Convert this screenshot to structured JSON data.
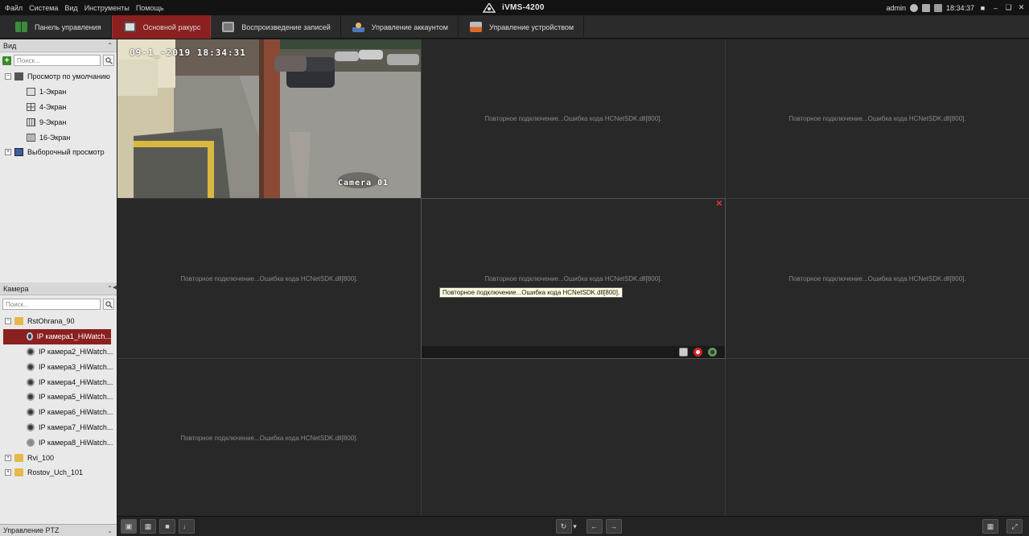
{
  "menubar": {
    "items": [
      "Файл",
      "Система",
      "Вид",
      "Инструменты",
      "Помощь"
    ],
    "app_title": "iVMS-4200",
    "user": "admin",
    "time": "18:34:37"
  },
  "tabs": [
    {
      "label": "Панель управления",
      "icon": "dashboard-icon",
      "active": false
    },
    {
      "label": "Основной ракурс",
      "icon": "main-view-icon",
      "active": true
    },
    {
      "label": "Воспроизведение записей",
      "icon": "playback-icon",
      "active": false
    },
    {
      "label": "Управление аккаунтом",
      "icon": "account-icon",
      "active": false
    },
    {
      "label": "Управление устройством",
      "icon": "device-icon",
      "active": false
    }
  ],
  "view_panel": {
    "title": "Вид",
    "search_placeholder": "Поиск...",
    "default_view": "Просмотр по умолчанию",
    "screens": [
      "1-Экран",
      "4-Экран",
      "9-Экран",
      "16-Экран"
    ],
    "custom_view": "Выборочный просмотр"
  },
  "camera_panel": {
    "title": "Камера",
    "search_placeholder": "Поиск...",
    "group": "RstOhrana_90",
    "cameras": [
      "IP камера1_HiWatch...",
      "IP камера2_HiWatch...",
      "IP камера3_HiWatch...",
      "IP камера4_HiWatch...",
      "IP камера5_HiWatch...",
      "IP камера6_HiWatch...",
      "IP камера7_HiWatch...",
      "IP камера8_HiWatch..."
    ],
    "other_groups": [
      "Rvi_100",
      "Rostov_Uch_101"
    ]
  },
  "ptz_panel": {
    "title": "Управление PTZ"
  },
  "grid": {
    "error_msg": "Повторное подключение...Ошибка кода HCNetSDK.dll[800].",
    "tooltip": "Повторное подключение...Ошибка кода HCNetSDK.dll[800].",
    "feed_timestamp": "09-1_-2019 18:34:31",
    "feed_label": "Camera 01"
  },
  "colors": {
    "accent": "#8b2020",
    "error_x": "#ee3333"
  }
}
